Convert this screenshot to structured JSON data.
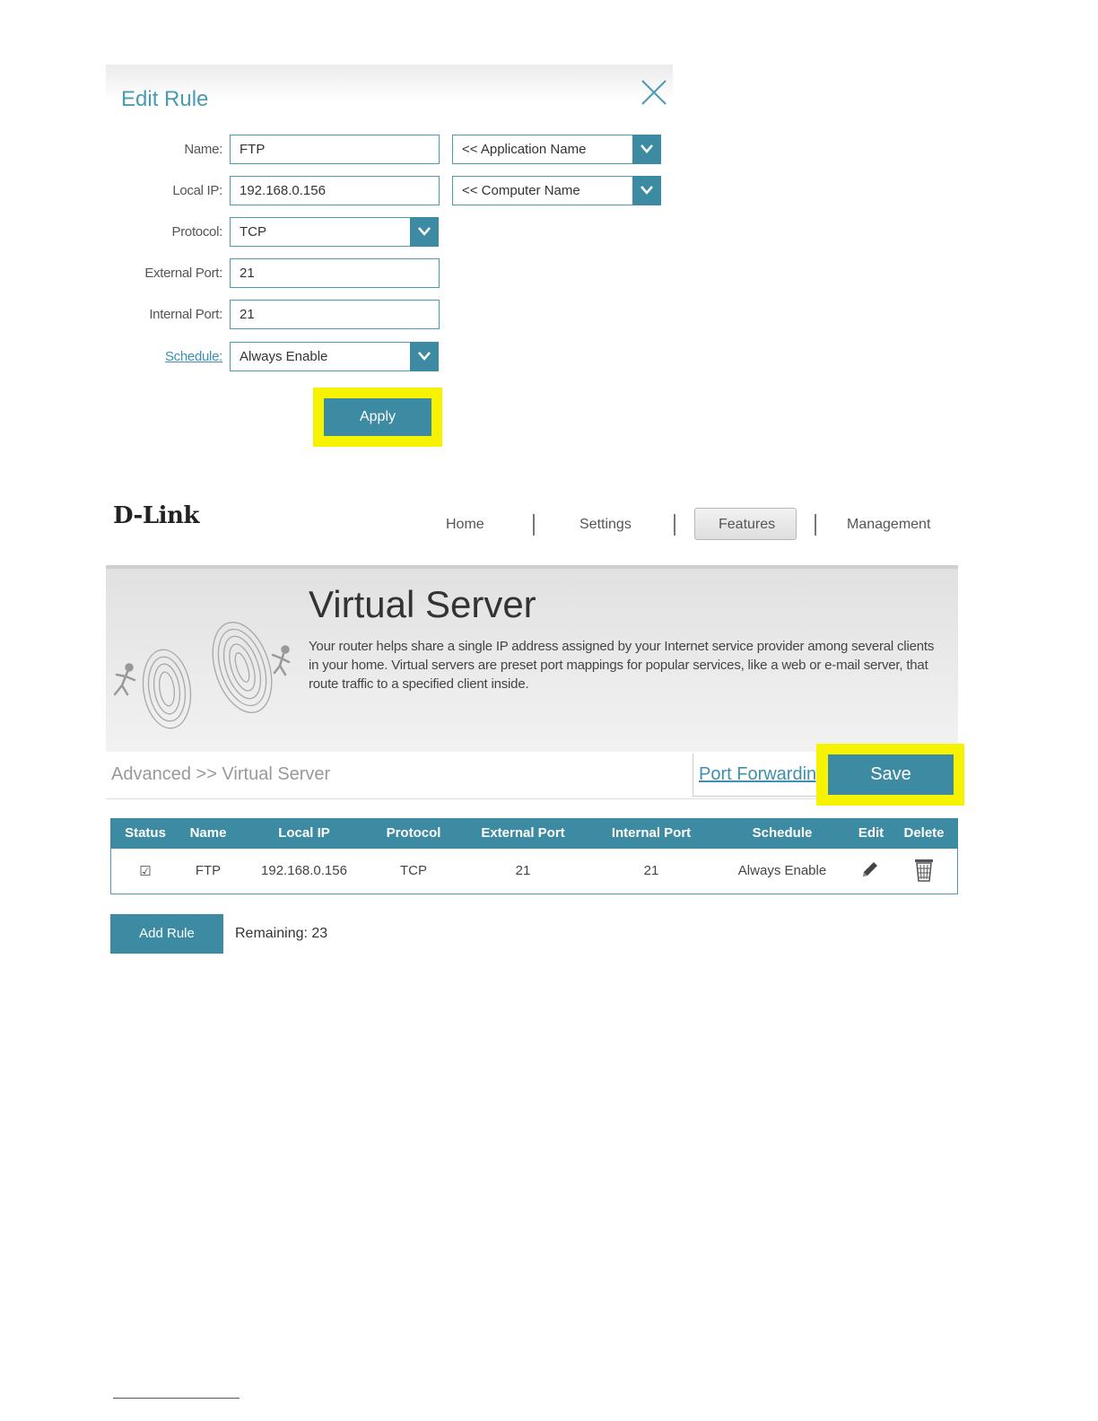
{
  "edit_rule": {
    "title": "Edit Rule",
    "fields": {
      "name_label": "Name:",
      "name_value": "FTP",
      "application_name_select": "<< Application Name",
      "local_ip_label": "Local IP:",
      "local_ip_value": "192.168.0.156",
      "computer_name_select": "<< Computer Name",
      "protocol_label": "Protocol:",
      "protocol_value": "TCP",
      "external_port_label": "External Port:",
      "external_port_value": "21",
      "internal_port_label": "Internal Port:",
      "internal_port_value": "21",
      "schedule_label": "Schedule:",
      "schedule_value": "Always Enable"
    },
    "apply_label": "Apply"
  },
  "header": {
    "logo": "D-Link",
    "nav": [
      "Home",
      "Settings",
      "Features",
      "Management"
    ],
    "active_nav": "Features"
  },
  "banner": {
    "title": "Virtual Server",
    "description": "Your router helps share a single IP address assigned by your Internet service provider among several clients in your home. Virtual servers are preset port mappings for popular services, like a web or e-mail server, that route traffic to a specified client inside."
  },
  "breadcrumb": "Advanced >> Virtual Server",
  "port_forwarding_link": "Port Forwarding",
  "save_label": "Save",
  "table": {
    "columns": [
      "Status",
      "Name",
      "Local IP",
      "Protocol",
      "External Port",
      "Internal Port",
      "Schedule",
      "Edit",
      "Delete"
    ],
    "rows": [
      {
        "status": "☑",
        "name": "FTP",
        "local_ip": "192.168.0.156",
        "protocol": "TCP",
        "external_port": "21",
        "internal_port": "21",
        "schedule": "Always Enable"
      }
    ]
  },
  "add_rule_label": "Add Rule",
  "remaining": "Remaining: 23",
  "colors": {
    "accent": "#3d8aa3",
    "highlight": "#f7f200",
    "link": "#3f8fb0"
  },
  "icons": [
    "close-icon",
    "chevron-down-icon",
    "pencil-icon",
    "trash-icon",
    "checkbox-checked-icon"
  ]
}
